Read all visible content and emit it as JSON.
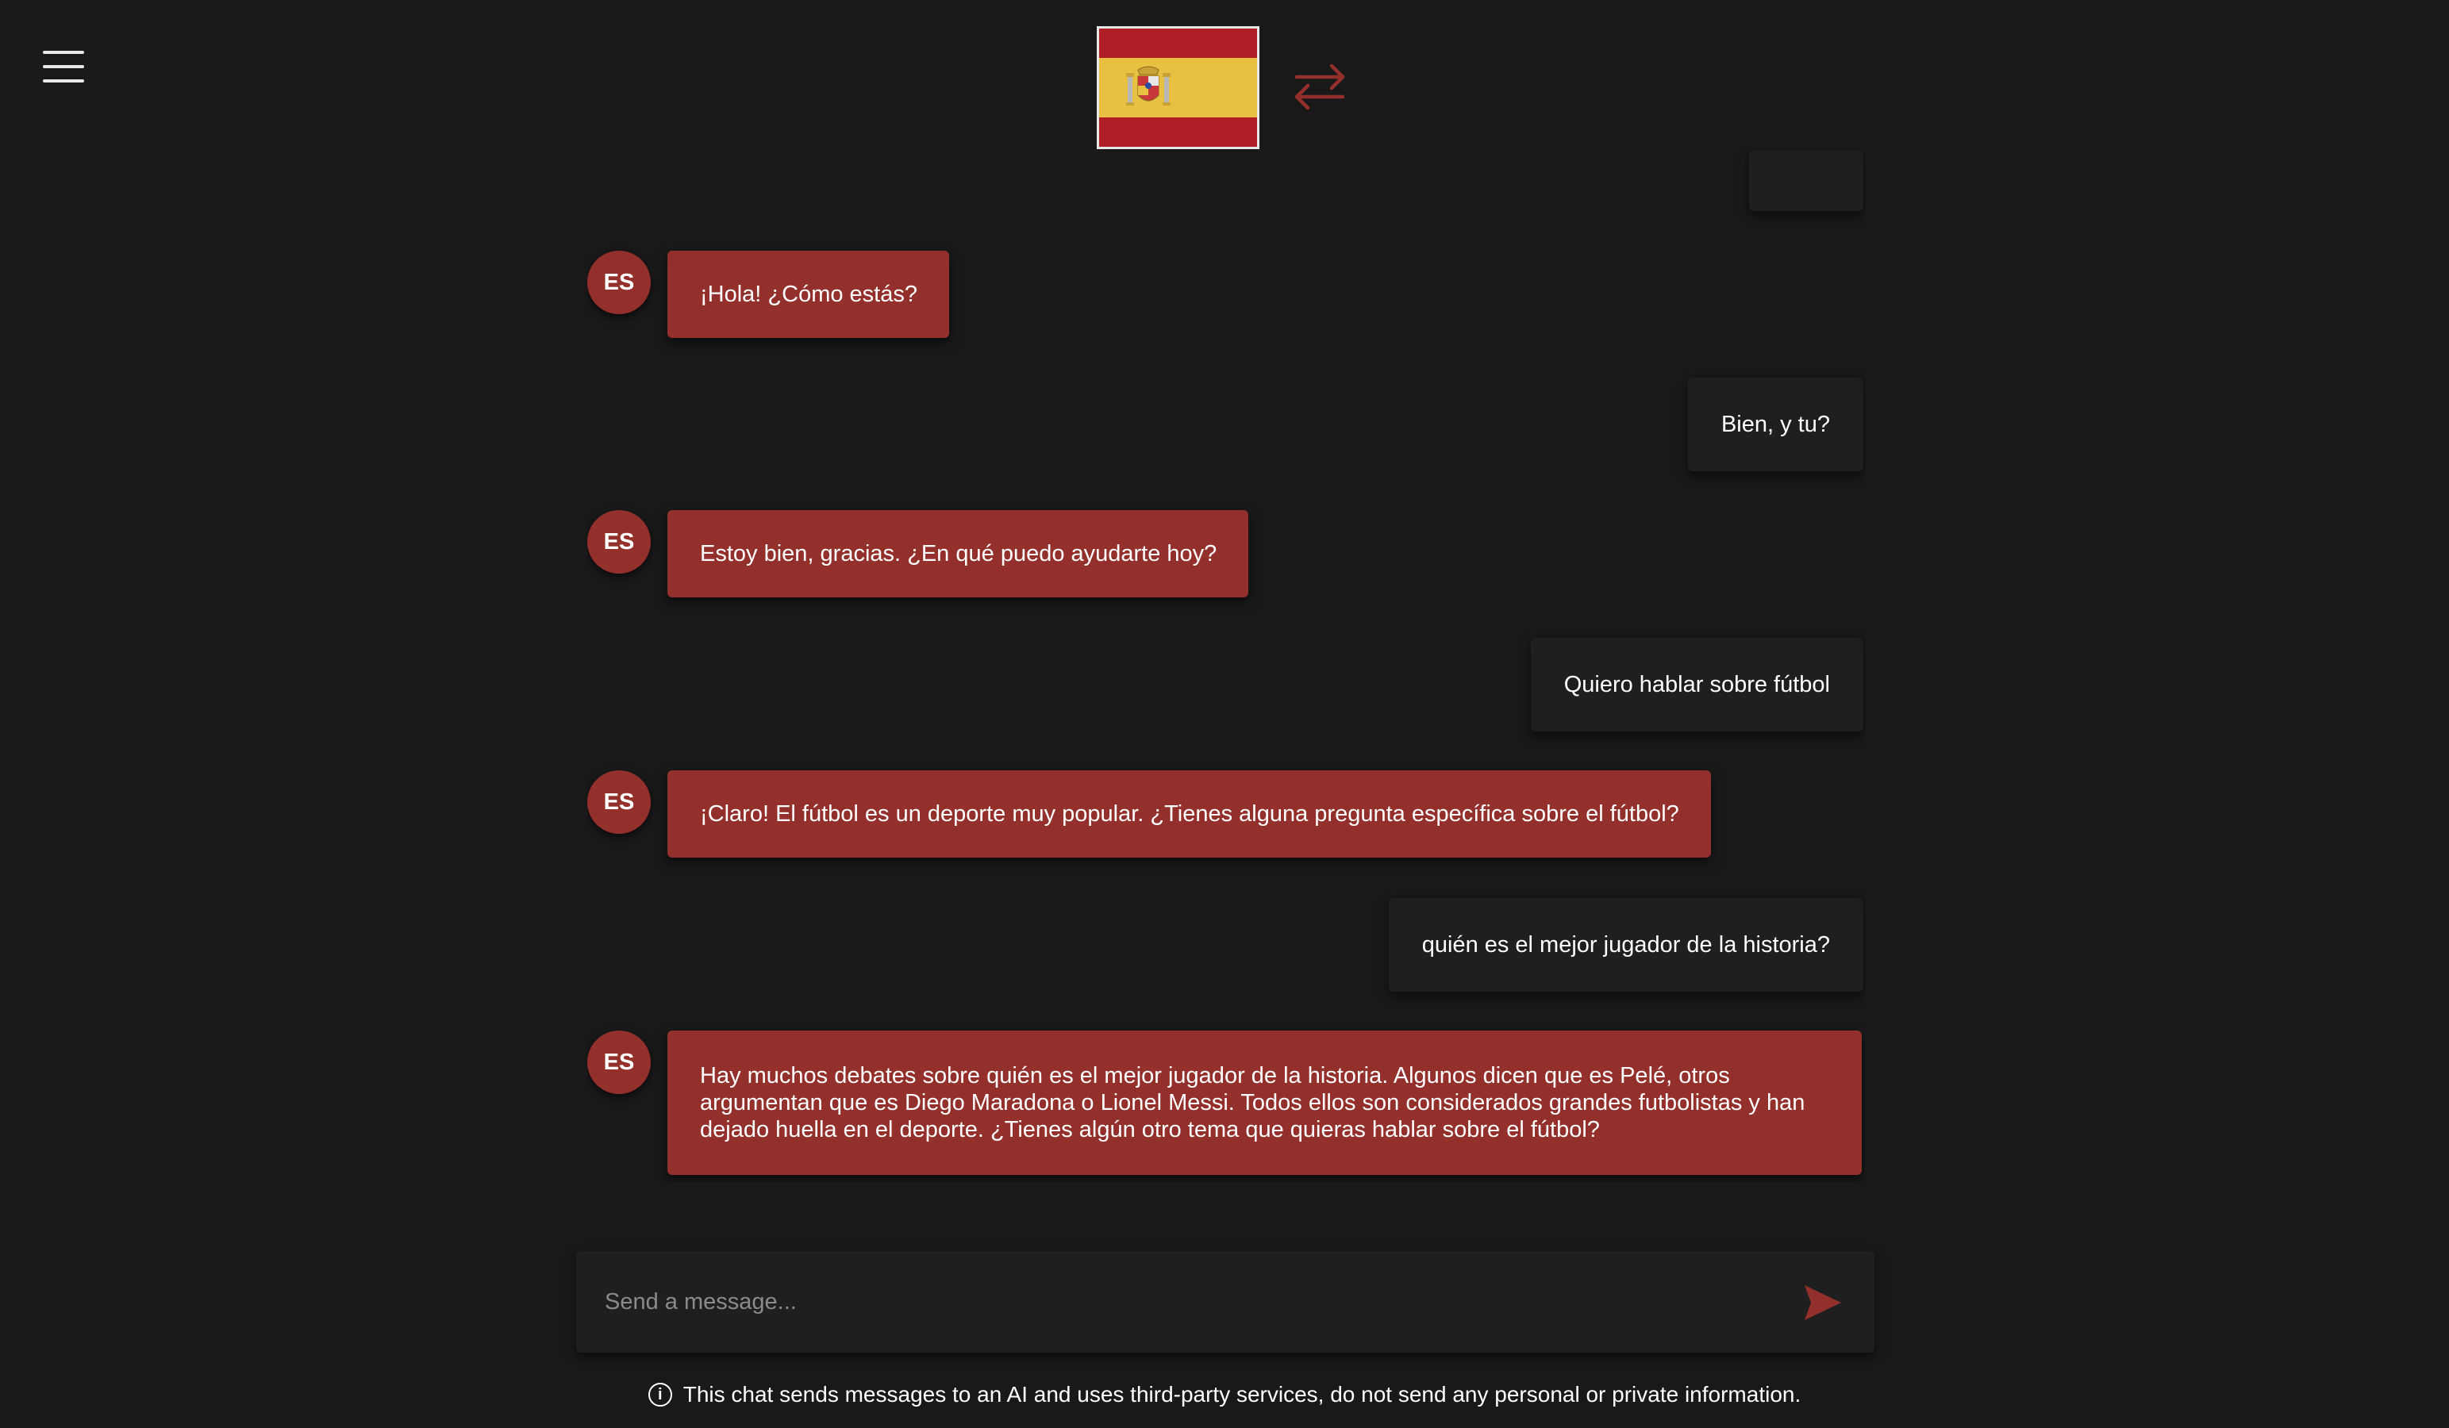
{
  "header": {
    "menu_icon": "hamburger-menu-icon",
    "language_flag_icon": "spain-flag-icon",
    "swap_icon": "swap-arrows-icon",
    "accent_color": "#93302c"
  },
  "chat": {
    "avatar_label": "ES",
    "messages": [
      {
        "role": "assistant",
        "text": "¡Hola! ¿Cómo estás?"
      },
      {
        "role": "user",
        "text": "Bien, y tu?"
      },
      {
        "role": "assistant",
        "text": "Estoy bien, gracias. ¿En qué puedo ayudarte hoy?"
      },
      {
        "role": "user",
        "text": "Quiero hablar sobre fútbol"
      },
      {
        "role": "assistant",
        "text": "¡Claro! El fútbol es un deporte muy popular. ¿Tienes alguna pregunta específica sobre el fútbol?"
      },
      {
        "role": "user",
        "text": "quién es el mejor jugador de la historia?"
      },
      {
        "role": "assistant",
        "text": "Hay muchos debates sobre quién es el mejor jugador de la historia. Algunos dicen que es Pelé, otros argumentan que es Diego Maradona o Lionel Messi. Todos ellos son considerados grandes futbolistas y han dejado huella en el deporte. ¿Tienes algún otro tema que quieras hablar sobre el fútbol?"
      }
    ]
  },
  "composer": {
    "placeholder": "Send a message...",
    "send_icon": "send-arrow-icon"
  },
  "footer": {
    "info_icon": "info-icon",
    "disclaimer": "This chat sends messages to an AI and uses third-party services, do not send any personal or private information."
  }
}
